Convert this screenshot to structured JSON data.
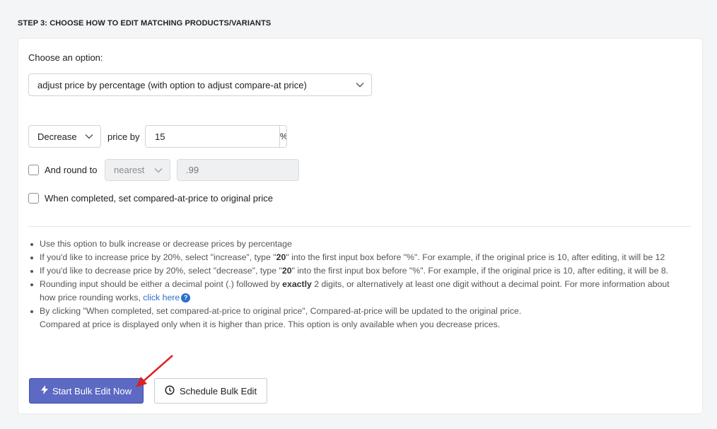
{
  "step_title": "STEP 3: CHOOSE HOW TO EDIT MATCHING PRODUCTS/VARIANTS",
  "choose_label": "Choose an option:",
  "option_select": {
    "value": "adjust price by percentage (with option to adjust compare-at price)"
  },
  "direction_select": {
    "value": "Decrease"
  },
  "price_by_label": "price by",
  "percent_input": {
    "value": "15"
  },
  "percent_suffix": "%",
  "round": {
    "label": "And round to",
    "mode": "nearest",
    "value_placeholder": ".99",
    "checked": false
  },
  "compare_at": {
    "label": "When completed, set compared-at-price to original price",
    "checked": false
  },
  "notes": {
    "n1": "Use this option to bulk increase or decrease prices by percentage",
    "n2_a": "If you'd like to increase price by 20%, select \"increase\", type \"",
    "n2_b": "20",
    "n2_c": "\" into the first input box before \"%\". For example, if the original price is 10, after editing, it will be 12",
    "n3_a": "If you'd like to decrease price by 20%, select \"decrease\", type \"",
    "n3_b": "20",
    "n3_c": "\" into the first input box before \"%\". For example, if the original price is 10, after editing, it will be 8.",
    "n4_a": "Rounding input should be either a decimal point (.) followed by ",
    "n4_b": "exactly",
    "n4_c": " 2 digits, or alternatively at least one digit without a decimal point. For more information about how price rounding works, ",
    "n4_link": "click here",
    "n5_a": "By clicking \"When completed, set compared-at-price to original price\", Compared-at-price will be updated to the original price.",
    "n5_b": "Compared at price is displayed only when it is higher than price. This option is only available when you decrease prices."
  },
  "buttons": {
    "start": "Start Bulk Edit Now",
    "schedule": "Schedule Bulk Edit"
  },
  "colors": {
    "primary": "#5c6ac4",
    "link": "#2c6ecb",
    "annotation_arrow": "#e02020"
  },
  "icons": {
    "start": "lightning-icon",
    "schedule": "clock-icon",
    "select": "chevron-down-icon",
    "help": "question-circle-icon"
  }
}
